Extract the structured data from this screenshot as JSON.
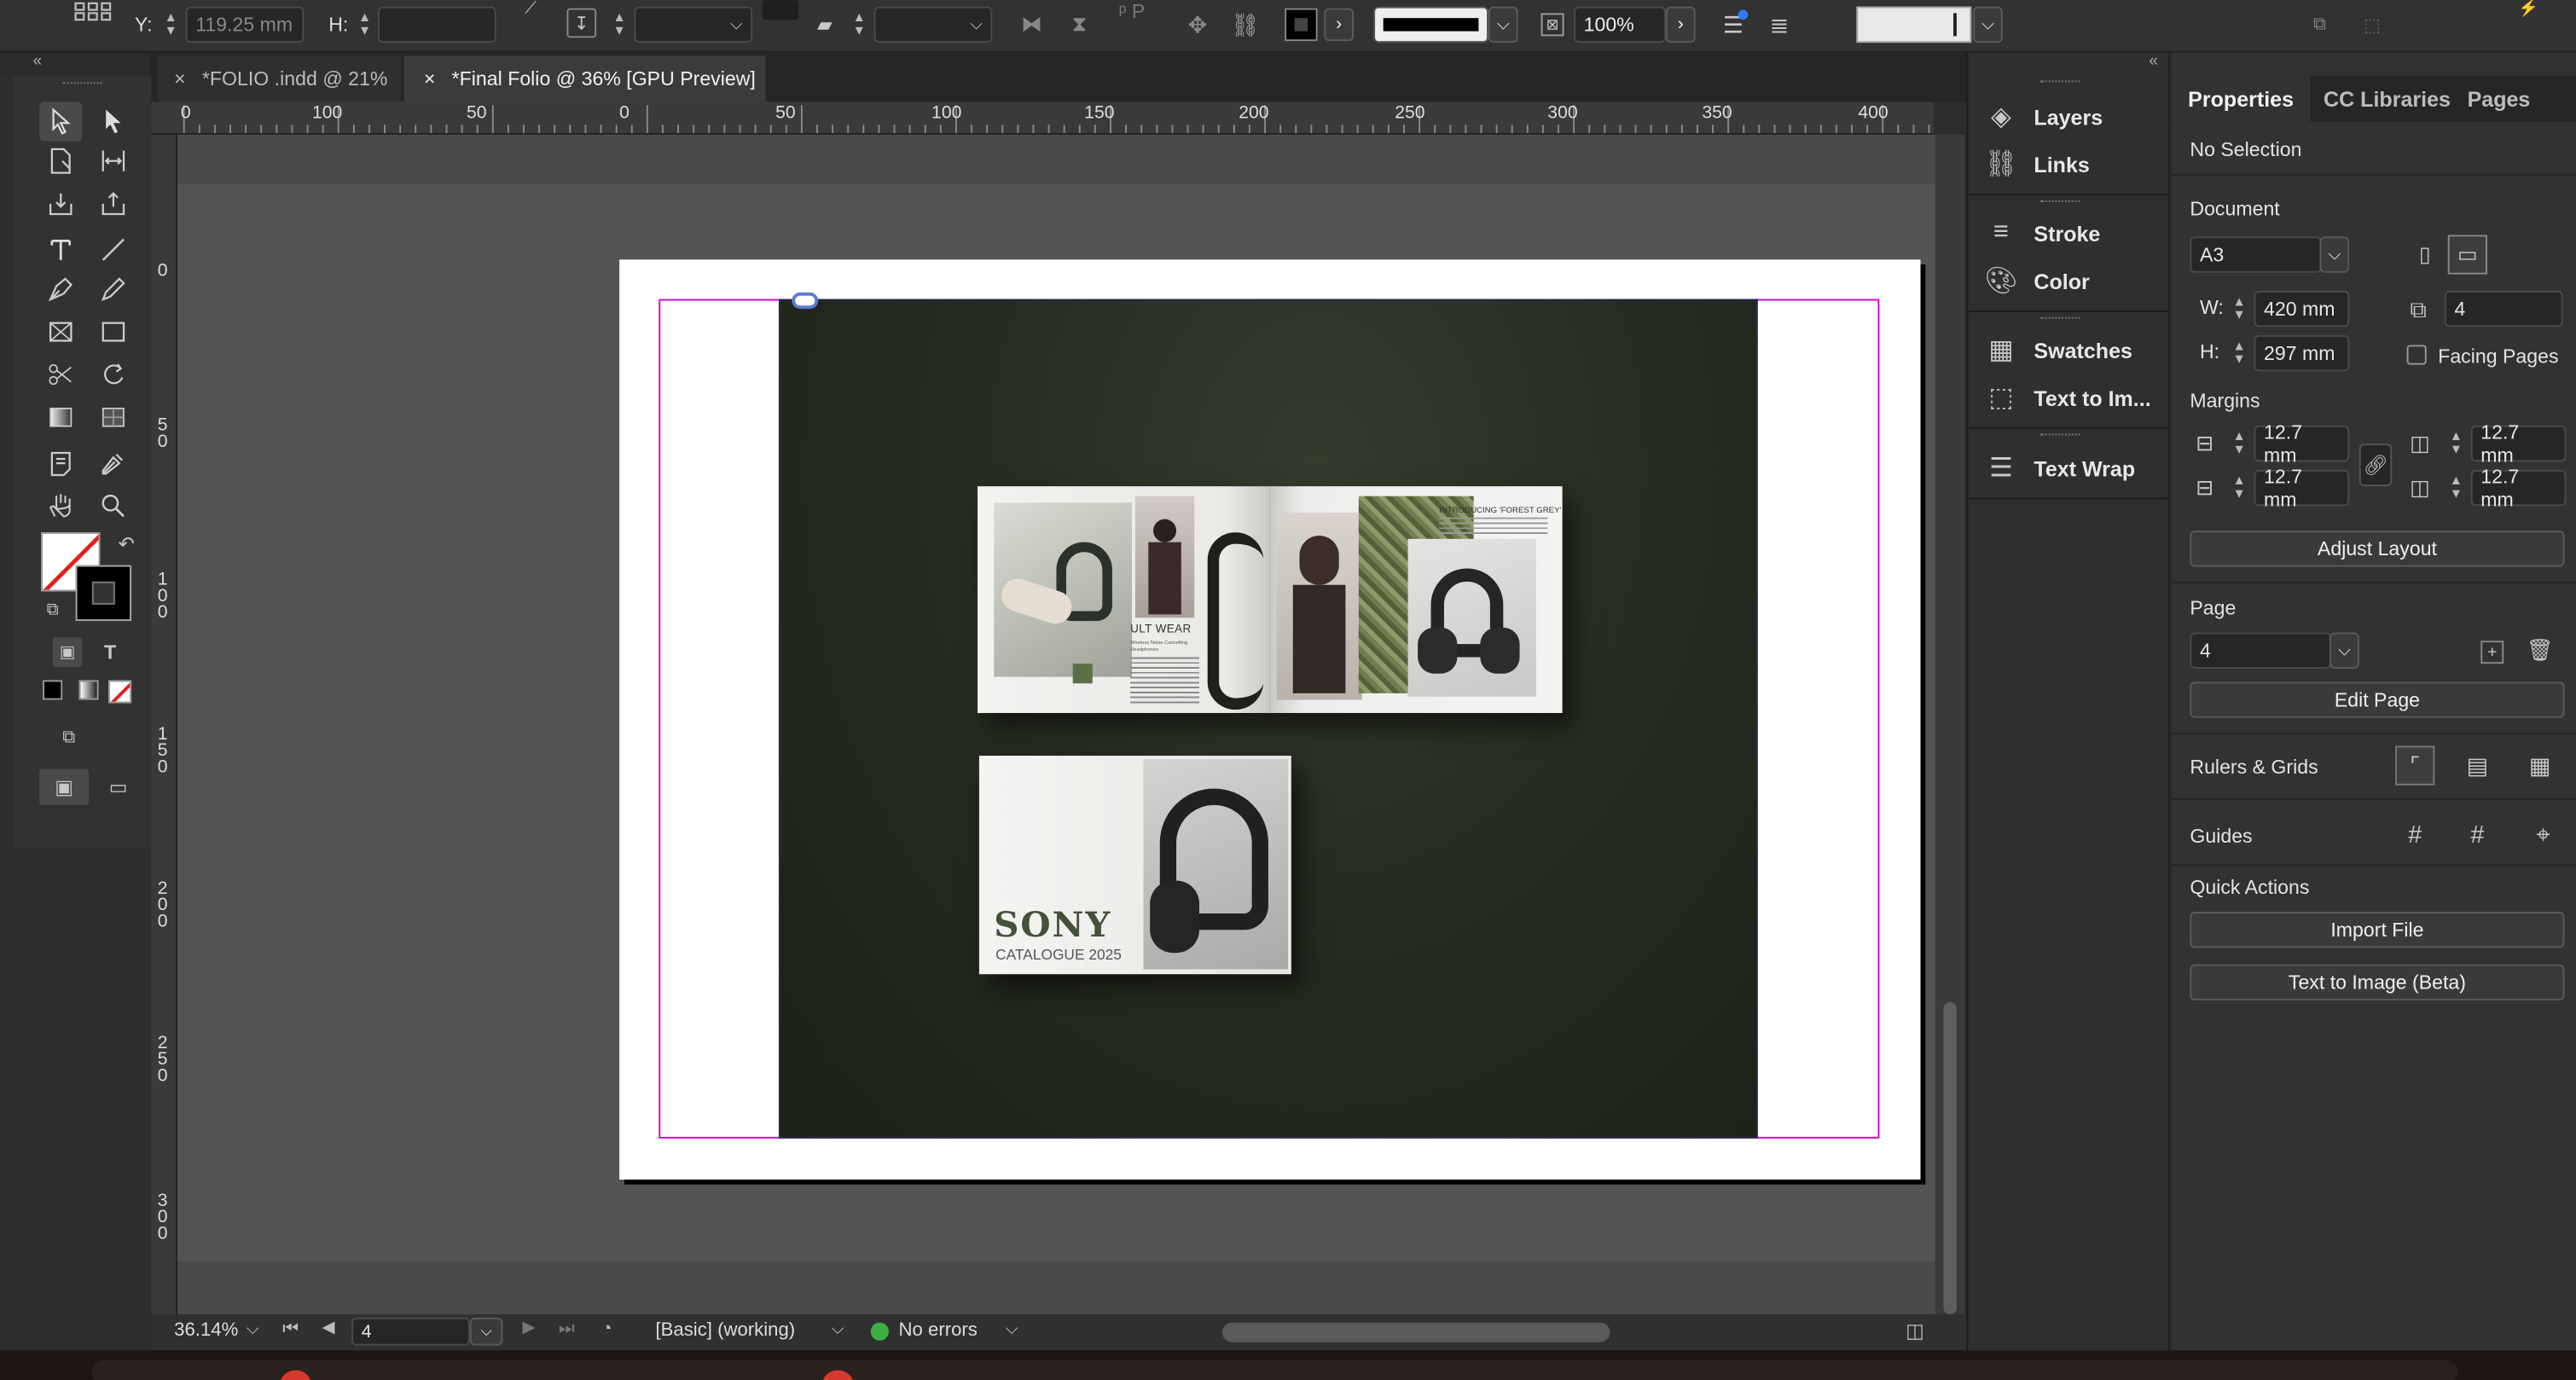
{
  "control_bar": {
    "y_label": "Y:",
    "y_value": "119.25 mm",
    "h_label": "H:",
    "zoom_value": "100%"
  },
  "tabs": [
    {
      "label": "*FOLIO .indd @ 21%",
      "close": "×"
    },
    {
      "label": "*Final Folio @ 36% [GPU Preview]",
      "close": "×"
    }
  ],
  "ruler": {
    "h_ticks": [
      "0",
      "100",
      "50",
      "0",
      "50",
      "100",
      "150",
      "200",
      "250",
      "300",
      "350",
      "400"
    ],
    "v_ticks": [
      "0",
      "5\n0",
      "1\n0\n0",
      "1\n5\n0",
      "2\n0\n0",
      "2\n5\n0",
      "3\n0\n0"
    ]
  },
  "artwork": {
    "brand": "SONY",
    "catalogue": "CATALOGUE 2025",
    "spread_headline": "ULT WEAR",
    "spread_sub": "Wireless Noise Cancelling Headphones",
    "spread_right_title": "INTRODUCING 'FOREST GREY'"
  },
  "status_bar": {
    "zoom": "36.14%",
    "page": "4",
    "profile": "[Basic] (working)",
    "errors": "No errors"
  },
  "mid_panel": {
    "items": [
      {
        "label": "Layers",
        "icon": "layers-icon"
      },
      {
        "label": "Links",
        "icon": "links-icon"
      },
      {
        "label": "Stroke",
        "icon": "stroke-icon"
      },
      {
        "label": "Color",
        "icon": "color-icon"
      },
      {
        "label": "Swatches",
        "icon": "swatches-icon"
      },
      {
        "label": "Text to Im...",
        "icon": "text-to-image-icon"
      },
      {
        "label": "Text Wrap",
        "icon": "text-wrap-icon"
      }
    ]
  },
  "properties": {
    "tabs": [
      "Properties",
      "CC Libraries",
      "Pages"
    ],
    "no_selection": "No Selection",
    "document_heading": "Document",
    "preset": "A3",
    "w_label": "W:",
    "w_value": "420 mm",
    "h_label": "H:",
    "h_value": "297 mm",
    "pages_value": "4",
    "facing_pages": "Facing Pages",
    "margins_heading": "Margins",
    "margin_top": "12.7 mm",
    "margin_bottom": "12.7 mm",
    "margin_left": "12.7 mm",
    "margin_right": "12.7 mm",
    "adjust_layout": "Adjust Layout",
    "page_heading": "Page",
    "page_value": "4",
    "edit_page": "Edit Page",
    "rulers_grids": "Rulers & Grids",
    "guides": "Guides",
    "quick_actions": "Quick Actions",
    "import_file": "Import File",
    "text_to_image": "Text to Image (Beta)"
  },
  "colors": {
    "accent_selection": "#d500d5",
    "artwork_bg": "#232a1d",
    "no_errors_dot": "#3cb043"
  }
}
